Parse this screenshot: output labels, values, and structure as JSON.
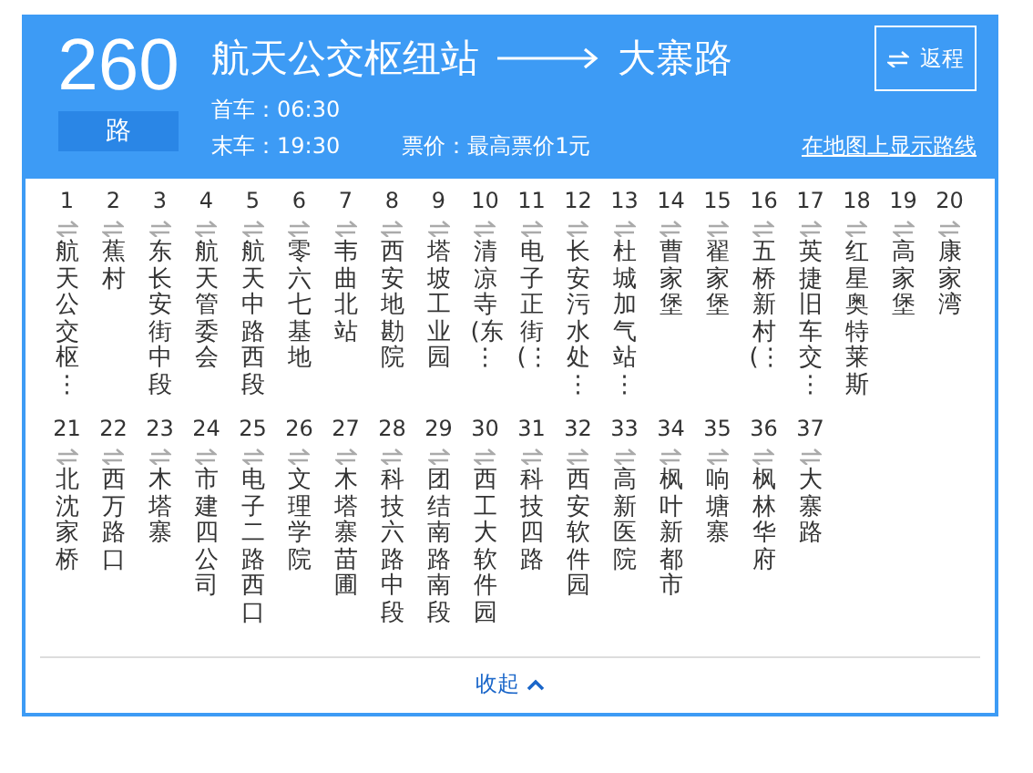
{
  "route": {
    "number": "260",
    "unit": "路",
    "origin": "航天公交枢纽站",
    "destination": "大寨路",
    "return_button": "返程",
    "first_bus": "首车：06:30",
    "last_bus": "末车：19:30",
    "fare": "票价：最高票价1元",
    "map_link": "在地图上显示路线"
  },
  "stops": [
    {
      "index": "1",
      "name": "航天公交枢⋮"
    },
    {
      "index": "2",
      "name": "蕉村"
    },
    {
      "index": "3",
      "name": "东长安街中段"
    },
    {
      "index": "4",
      "name": "航天管委会"
    },
    {
      "index": "5",
      "name": "航天中路西段"
    },
    {
      "index": "6",
      "name": "零六七基地"
    },
    {
      "index": "7",
      "name": "韦曲北站"
    },
    {
      "index": "8",
      "name": "西安地勘院"
    },
    {
      "index": "9",
      "name": "塔坡工业园"
    },
    {
      "index": "10",
      "name": "清凉寺(东⋮"
    },
    {
      "index": "11",
      "name": "电子正街(⋮"
    },
    {
      "index": "12",
      "name": "长安污水处⋮"
    },
    {
      "index": "13",
      "name": "杜城加气站⋮"
    },
    {
      "index": "14",
      "name": "曹家堡"
    },
    {
      "index": "15",
      "name": "翟家堡"
    },
    {
      "index": "16",
      "name": "五桥新村(⋮"
    },
    {
      "index": "17",
      "name": "英捷旧车交⋮"
    },
    {
      "index": "18",
      "name": "红星奥特莱斯"
    },
    {
      "index": "19",
      "name": "高家堡"
    },
    {
      "index": "20",
      "name": "康家湾"
    },
    {
      "index": "21",
      "name": "北沈家桥"
    },
    {
      "index": "22",
      "name": "西万路口"
    },
    {
      "index": "23",
      "name": "木塔寨"
    },
    {
      "index": "24",
      "name": "市建四公司"
    },
    {
      "index": "25",
      "name": "电子二路西口"
    },
    {
      "index": "26",
      "name": "文理学院"
    },
    {
      "index": "27",
      "name": "木塔寨苗圃"
    },
    {
      "index": "28",
      "name": "科技六路中段"
    },
    {
      "index": "29",
      "name": "团结南路南段"
    },
    {
      "index": "30",
      "name": "西工大软件园"
    },
    {
      "index": "31",
      "name": "科技四路"
    },
    {
      "index": "32",
      "name": "西安软件园"
    },
    {
      "index": "33",
      "name": "高新医院"
    },
    {
      "index": "34",
      "name": "枫叶新都市"
    },
    {
      "index": "35",
      "name": "响塘寨"
    },
    {
      "index": "36",
      "name": "枫林华府"
    },
    {
      "index": "37",
      "name": "大寨路"
    }
  ],
  "collapse_button": "收起"
}
